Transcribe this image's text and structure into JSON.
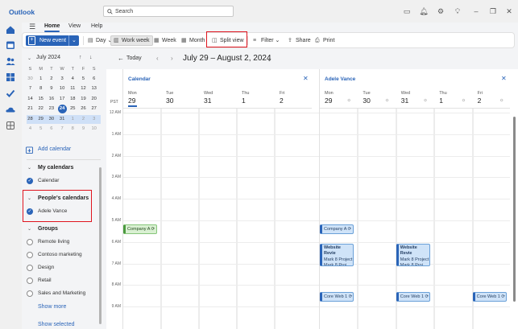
{
  "app": {
    "title": "Outlook"
  },
  "search": {
    "placeholder": "Search"
  },
  "titlebar_icons": [
    "present-icon",
    "bell-icon",
    "settings-icon",
    "lightbulb-icon",
    "minimize-icon",
    "restore-icon",
    "close-icon"
  ],
  "menu": {
    "tabs": [
      "Home",
      "View",
      "Help"
    ],
    "active": "Home"
  },
  "ribbon": {
    "new_event": "New event",
    "day": "Day",
    "work_week": "Work week",
    "week": "Week",
    "month": "Month",
    "split_view": "Split view",
    "filter": "Filter",
    "share": "Share",
    "print": "Print"
  },
  "minical": {
    "month": "July 2024",
    "weekdays": [
      "S",
      "M",
      "T",
      "W",
      "T",
      "F",
      "S"
    ],
    "weeks": [
      [
        "30",
        "1",
        "2",
        "3",
        "4",
        "5",
        "6"
      ],
      [
        "7",
        "8",
        "9",
        "10",
        "11",
        "12",
        "13"
      ],
      [
        "14",
        "15",
        "16",
        "17",
        "18",
        "19",
        "20"
      ],
      [
        "21",
        "22",
        "23",
        "24",
        "25",
        "26",
        "27"
      ],
      [
        "28",
        "29",
        "30",
        "31",
        "1",
        "2",
        "3"
      ],
      [
        "4",
        "5",
        "6",
        "7",
        "8",
        "9",
        "10"
      ]
    ],
    "today": "24"
  },
  "sidebar": {
    "add_calendar": "Add calendar",
    "my_calendars": "My calendars",
    "my_items": [
      "Calendar"
    ],
    "peoples_calendars": "People's calendars",
    "people_items": [
      "Adele Vance"
    ],
    "groups": "Groups",
    "group_items": [
      "Remote living",
      "Contoso marketing",
      "Design",
      "Retail",
      "Sales and Marketing"
    ],
    "show_more": "Show more",
    "show_selected": "Show selected"
  },
  "datebar": {
    "today": "Today",
    "range": "July 29 – August 2, 2024"
  },
  "timezone": "PST",
  "hours": [
    "12 AM",
    "1 AM",
    "2 AM",
    "3 AM",
    "4 AM",
    "5 AM",
    "6 AM",
    "7 AM",
    "8 AM",
    "9 AM"
  ],
  "panels": [
    {
      "title": "Calendar",
      "days": [
        {
          "name": "Mon",
          "date": "29"
        },
        {
          "name": "Tue",
          "date": "30"
        },
        {
          "name": "Wed",
          "date": "31"
        },
        {
          "name": "Thu",
          "date": "1"
        },
        {
          "name": "Fri",
          "date": "2"
        }
      ]
    },
    {
      "title": "Adele Vance",
      "days": [
        {
          "name": "Mon",
          "date": "29"
        },
        {
          "name": "Tue",
          "date": "30"
        },
        {
          "name": "Wed",
          "date": "31"
        },
        {
          "name": "Thu",
          "date": "1"
        },
        {
          "name": "Fri",
          "date": "2"
        }
      ]
    }
  ],
  "events": {
    "company_cal": "Company A",
    "company_adele": "Company A",
    "review_mon_title": "Website Revie",
    "review_mon_l2": "Mark 8 Project",
    "review_mon_l3": "Mark 8 Proj",
    "review_wed_title": "Website Revie",
    "review_wed_l2": "Mark 8 Project",
    "review_wed_l3": "Mark 8 Proj",
    "core_mon": "Core Web 1",
    "core_wed": "Core Web 1",
    "core_fri": "Core Web 1"
  },
  "colors": {
    "accent": "#2a64b8",
    "highlight": "#e0141e",
    "event_blue": "#cfe3f8",
    "event_green": "#d9f0d2"
  }
}
